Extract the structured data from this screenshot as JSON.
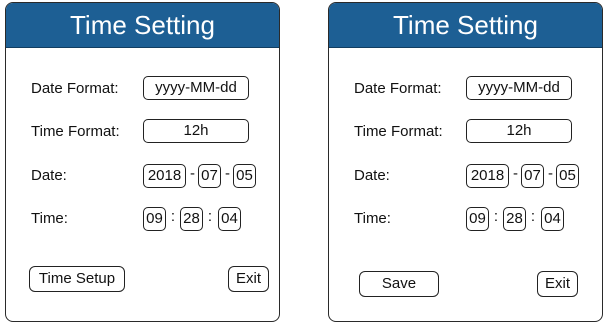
{
  "panels": [
    {
      "title": "Time Setting",
      "date_format_label": "Date Format:",
      "date_format_value": "yyyy-MM-dd",
      "time_format_label": "Time Format:",
      "time_format_value": "12h",
      "date_label": "Date:",
      "date_year": "2018",
      "date_month": "07",
      "date_day": "05",
      "date_sep": "-",
      "time_label": "Time:",
      "time_hour": "09",
      "time_minute": "28",
      "time_second": "04",
      "time_sep": ":",
      "left_button": "Time Setup",
      "exit_button": "Exit"
    },
    {
      "title": "Time Setting",
      "date_format_label": "Date Format:",
      "date_format_value": "yyyy-MM-dd",
      "time_format_label": "Time Format:",
      "time_format_value": "12h",
      "date_label": "Date:",
      "date_year": "2018",
      "date_month": "07",
      "date_day": "05",
      "date_sep": "-",
      "time_label": "Time:",
      "time_hour": "09",
      "time_minute": "28",
      "time_second": "04",
      "time_sep": ":",
      "left_button": "Save",
      "exit_button": "Exit"
    }
  ],
  "colors": {
    "header_bg": "#1d5f94",
    "header_text": "#ffffff",
    "border": "#222222"
  }
}
